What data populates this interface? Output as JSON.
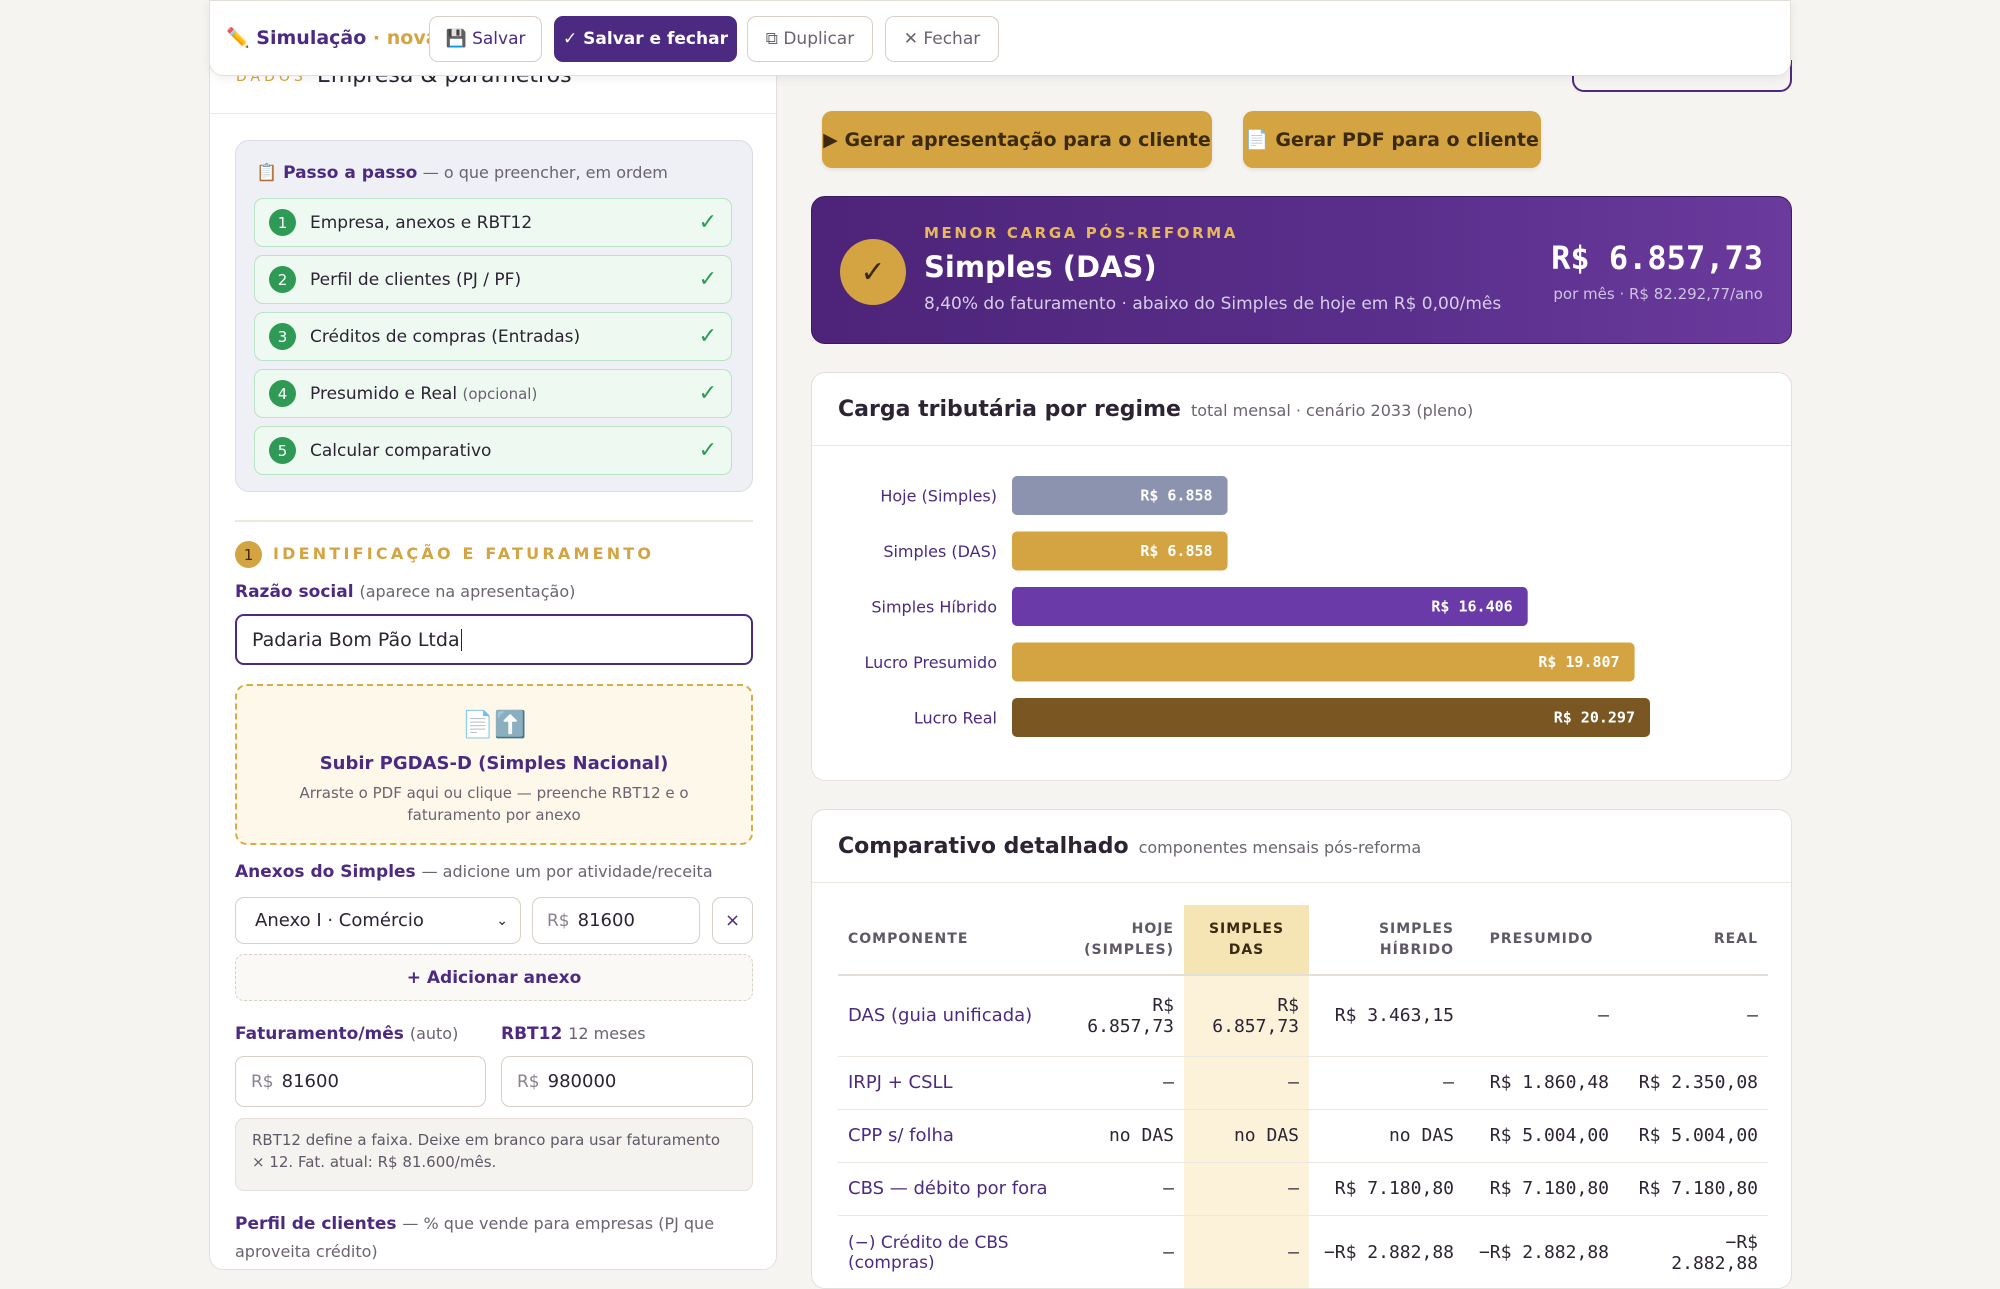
{
  "toolbar": {
    "icon": "pencil-icon",
    "title": "Simulação",
    "title_separator": "·",
    "state": "nova",
    "save_label": "💾 Salvar",
    "save_close_label": "✓ Salvar e fechar",
    "duplicate_label": "⧉ Duplicar",
    "close_label": "✕ Fechar"
  },
  "left": {
    "eyebrow": "DADOS",
    "title": "Empresa & parâmetros",
    "steps": {
      "title": "📋 Passo a passo",
      "subtitle": "— o que preencher, em ordem",
      "items": [
        {
          "num": "1",
          "label": "Empresa, anexos e RBT12",
          "note": "",
          "done": "✓"
        },
        {
          "num": "2",
          "label": "Perfil de clientes (PJ / PF)",
          "note": "",
          "done": "✓"
        },
        {
          "num": "3",
          "label": "Créditos de compras (Entradas)",
          "note": "",
          "done": "✓"
        },
        {
          "num": "4",
          "label": "Presumido e Real",
          "note": "(opcional)",
          "done": "✓"
        },
        {
          "num": "5",
          "label": "Calcular comparativo",
          "note": "",
          "done": "✓"
        }
      ]
    },
    "section1": {
      "num": "1",
      "title": "IDENTIFICAÇÃO E FATURAMENTO"
    },
    "razao": {
      "label": "Razão social",
      "hint": "(aparece na apresentação)",
      "value": "Padaria Bom Pão Ltda"
    },
    "upload": {
      "icons": "📄⬆️",
      "title": "Subir PGDAS-D (Simples Nacional)",
      "subtitle": "Arraste o PDF aqui ou clique — preenche RBT12 e o faturamento por anexo"
    },
    "anexos": {
      "label": "Anexos do Simples",
      "hint": "— adicione um por atividade/receita",
      "selected": "Anexo I · Comércio",
      "currency": "R$",
      "amount": "81600",
      "remove_label": "×",
      "add_label": "+ Adicionar anexo"
    },
    "faturamento": {
      "label": "Faturamento/mês",
      "hint": "(auto)",
      "currency": "R$",
      "value": "81600"
    },
    "rbt12": {
      "label": "RBT12",
      "hint": "12 meses",
      "currency": "R$",
      "value": "980000"
    },
    "rbt_note": "RBT12 define a faixa. Deixe em branco para usar faturamento × 12. Fat. atual: R$ 81.600/mês.",
    "perfil": {
      "label": "Perfil de clientes",
      "hint": "— % que vende para empresas (PJ que aproveita crédito)"
    }
  },
  "actions": {
    "presentation_label": "▶ Gerar apresentação para o cliente",
    "pdf_label": "📄 Gerar PDF para o cliente"
  },
  "best": {
    "eyebrow": "MENOR CARGA PÓS-REFORMA",
    "regime": "Simples (DAS)",
    "subtitle": "8,40% do faturamento · abaixo do Simples de hoje em R$ 0,00/mês",
    "value": "R$ 6.857,73",
    "value_sub": "por mês · R$ 82.292,77/ano",
    "check": "✓"
  },
  "chart_card": {
    "title": "Carga tributária por regime",
    "subtitle": "total mensal · cenário 2033 (pleno)"
  },
  "chart_data": {
    "type": "bar",
    "orientation": "horizontal",
    "categories": [
      "Hoje (Simples)",
      "Simples (DAS)",
      "Simples Híbrido",
      "Lucro Presumido",
      "Lucro Real"
    ],
    "values": [
      6858,
      6858,
      16406,
      19807,
      20297
    ],
    "labels": [
      "R$ 6.858",
      "R$ 6.858",
      "R$ 16.406",
      "R$ 19.807",
      "R$ 20.297"
    ],
    "colors": [
      "#8c93ae",
      "#d3a441",
      "#6a3aa8",
      "#d3a441",
      "#7a5722"
    ],
    "xlim": [
      0,
      20297
    ]
  },
  "table_card": {
    "title": "Comparativo detalhado",
    "subtitle": "componentes mensais pós-reforma"
  },
  "table": {
    "headers": [
      "Componente",
      "Hoje (Simples)",
      "Simples DAS",
      "Simples Híbrido",
      "Presumido",
      "Real"
    ],
    "rows": [
      [
        "DAS (guia unificada)",
        "R$ 6.857,73",
        "R$ 6.857,73",
        "R$ 3.463,15",
        "—",
        "—"
      ],
      [
        "IRPJ + CSLL",
        "—",
        "—",
        "—",
        "R$ 1.860,48",
        "R$ 2.350,08"
      ],
      [
        "CPP s/ folha",
        "no DAS",
        "no DAS",
        "no DAS",
        "R$ 5.004,00",
        "R$ 5.004,00"
      ],
      [
        "CBS — débito por fora",
        "—",
        "—",
        "R$ 7.180,80",
        "R$ 7.180,80",
        "R$ 7.180,80"
      ],
      [
        "(−) Crédito de CBS (compras)",
        "—",
        "—",
        "−R$ 2.882,88",
        "−R$ 2.882,88",
        "−R$ 2.882,88"
      ]
    ]
  }
}
